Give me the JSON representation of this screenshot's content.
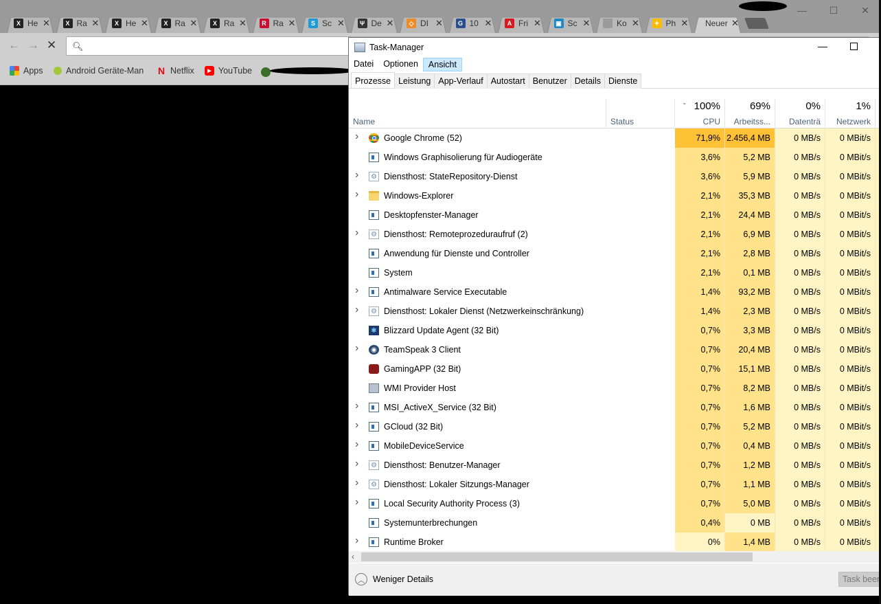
{
  "browser": {
    "tabs": [
      {
        "title": "He",
        "icon": "x-brand-icon",
        "color": "#222222",
        "glyph": "X"
      },
      {
        "title": "Ra",
        "icon": "x-brand-icon",
        "color": "#222222",
        "glyph": "X"
      },
      {
        "title": "He",
        "icon": "x-brand-icon",
        "color": "#222222",
        "glyph": "X"
      },
      {
        "title": "Ra",
        "icon": "x-brand-icon",
        "color": "#222222",
        "glyph": "X"
      },
      {
        "title": "Ra",
        "icon": "x-brand-icon",
        "color": "#222222",
        "glyph": "X"
      },
      {
        "title": "Ra",
        "icon": "red-logo-icon",
        "color": "#c8102e",
        "glyph": "R"
      },
      {
        "title": "Sc",
        "icon": "speech-bubble-icon",
        "color": "#1e9bd7",
        "glyph": "S"
      },
      {
        "title": "De",
        "icon": "trident-icon",
        "color": "#333333",
        "glyph": "Ψ"
      },
      {
        "title": "DI",
        "icon": "diamond-icon",
        "color": "#f08a24",
        "glyph": "◇"
      },
      {
        "title": "10",
        "icon": "cg-icon",
        "color": "#2a4d8f",
        "glyph": "G"
      },
      {
        "title": "Fri",
        "icon": "a1-icon",
        "color": "#d71920",
        "glyph": "A"
      },
      {
        "title": "Sc",
        "icon": "monitor-icon",
        "color": "#1e88c7",
        "glyph": "▣"
      },
      {
        "title": "Ko",
        "icon": "blank-icon",
        "color": "#9b9b9b",
        "glyph": ""
      },
      {
        "title": "Ph",
        "icon": "pinwheel-icon",
        "color": "#fbbc05",
        "glyph": "✦"
      },
      {
        "title": "Neuer",
        "icon": "none",
        "color": "#cfcfcf",
        "glyph": ""
      }
    ],
    "bookmarks": [
      {
        "label": "Apps",
        "icon": "apps-grid-icon"
      },
      {
        "label": "Android Geräte-Man",
        "icon": "android-icon"
      },
      {
        "label": "Netflix",
        "icon": "netflix-icon"
      },
      {
        "label": "YouTube",
        "icon": "youtube-icon"
      }
    ]
  },
  "taskmanager": {
    "title": "Task-Manager",
    "menu": [
      "Datei",
      "Optionen",
      "Ansicht"
    ],
    "tabs": [
      "Prozesse",
      "Leistung",
      "App-Verlauf",
      "Autostart",
      "Benutzer",
      "Details",
      "Dienste"
    ],
    "columns": {
      "name": "Name",
      "status": "Status",
      "cpu": {
        "pct": "100%",
        "label": "CPU"
      },
      "mem": {
        "pct": "69%",
        "label": "Arbeitss..."
      },
      "disk": {
        "pct": "0%",
        "label": "Datenträ"
      },
      "net": {
        "pct": "1%",
        "label": "Netzwerk"
      }
    },
    "rows": [
      {
        "expand": true,
        "icon": "chrome-icon",
        "name": "Google Chrome (52)",
        "cpu": "71,9%",
        "mem": "2.456,4 MB",
        "disk": "0 MB/s",
        "net": "0 MBit/s"
      },
      {
        "expand": false,
        "icon": "window-icon",
        "name": "Windows Graphisolierung für Audiogeräte",
        "cpu": "3,6%",
        "mem": "5,2 MB",
        "disk": "0 MB/s",
        "net": "0 MBit/s"
      },
      {
        "expand": true,
        "icon": "gear-icon",
        "name": "Diensthost: StateRepository-Dienst",
        "cpu": "3,6%",
        "mem": "5,9 MB",
        "disk": "0 MB/s",
        "net": "0 MBit/s"
      },
      {
        "expand": true,
        "icon": "folder-icon",
        "name": "Windows-Explorer",
        "cpu": "2,1%",
        "mem": "35,3 MB",
        "disk": "0 MB/s",
        "net": "0 MBit/s"
      },
      {
        "expand": false,
        "icon": "window-icon",
        "name": "Desktopfenster-Manager",
        "cpu": "2,1%",
        "mem": "24,4 MB",
        "disk": "0 MB/s",
        "net": "0 MBit/s"
      },
      {
        "expand": true,
        "icon": "gear-icon",
        "name": "Diensthost: Remoteprozeduraufruf (2)",
        "cpu": "2,1%",
        "mem": "6,9 MB",
        "disk": "0 MB/s",
        "net": "0 MBit/s"
      },
      {
        "expand": false,
        "icon": "window-icon",
        "name": "Anwendung für Dienste und Controller",
        "cpu": "2,1%",
        "mem": "2,8 MB",
        "disk": "0 MB/s",
        "net": "0 MBit/s"
      },
      {
        "expand": false,
        "icon": "window-icon",
        "name": "System",
        "cpu": "2,1%",
        "mem": "0,1 MB",
        "disk": "0 MB/s",
        "net": "0 MBit/s"
      },
      {
        "expand": true,
        "icon": "window-icon",
        "name": "Antimalware Service Executable",
        "cpu": "1,4%",
        "mem": "93,2 MB",
        "disk": "0 MB/s",
        "net": "0 MBit/s"
      },
      {
        "expand": true,
        "icon": "gear-icon",
        "name": "Diensthost: Lokaler Dienst (Netzwerkeinschränkung)",
        "cpu": "1,4%",
        "mem": "2,3 MB",
        "disk": "0 MB/s",
        "net": "0 MBit/s"
      },
      {
        "expand": false,
        "icon": "blizzard-icon",
        "name": "Blizzard Update Agent (32 Bit)",
        "cpu": "0,7%",
        "mem": "3,3 MB",
        "disk": "0 MB/s",
        "net": "0 MBit/s"
      },
      {
        "expand": true,
        "icon": "teamspeak-icon",
        "name": "TeamSpeak 3 Client",
        "cpu": "0,7%",
        "mem": "20,4 MB",
        "disk": "0 MB/s",
        "net": "0 MBit/s"
      },
      {
        "expand": false,
        "icon": "gaming-app-icon",
        "name": "GamingAPP (32 Bit)",
        "cpu": "0,7%",
        "mem": "15,1 MB",
        "disk": "0 MB/s",
        "net": "0 MBit/s"
      },
      {
        "expand": false,
        "icon": "wmi-icon",
        "name": "WMI Provider Host",
        "cpu": "0,7%",
        "mem": "8,2 MB",
        "disk": "0 MB/s",
        "net": "0 MBit/s"
      },
      {
        "expand": true,
        "icon": "window-icon",
        "name": "MSI_ActiveX_Service (32 Bit)",
        "cpu": "0,7%",
        "mem": "1,6 MB",
        "disk": "0 MB/s",
        "net": "0 MBit/s"
      },
      {
        "expand": true,
        "icon": "window-icon",
        "name": "GCloud (32 Bit)",
        "cpu": "0,7%",
        "mem": "5,2 MB",
        "disk": "0 MB/s",
        "net": "0 MBit/s"
      },
      {
        "expand": true,
        "icon": "window-icon",
        "name": "MobileDeviceService",
        "cpu": "0,7%",
        "mem": "0,4 MB",
        "disk": "0 MB/s",
        "net": "0 MBit/s"
      },
      {
        "expand": true,
        "icon": "gear-icon",
        "name": "Diensthost: Benutzer-Manager",
        "cpu": "0,7%",
        "mem": "1,2 MB",
        "disk": "0 MB/s",
        "net": "0 MBit/s"
      },
      {
        "expand": true,
        "icon": "gear-icon",
        "name": "Diensthost: Lokaler Sitzungs-Manager",
        "cpu": "0,7%",
        "mem": "1,1 MB",
        "disk": "0 MB/s",
        "net": "0 MBit/s"
      },
      {
        "expand": true,
        "icon": "window-icon",
        "name": "Local Security Authority Process (3)",
        "cpu": "0,7%",
        "mem": "5,0 MB",
        "disk": "0 MB/s",
        "net": "0 MBit/s"
      },
      {
        "expand": false,
        "icon": "window-icon",
        "name": "Systemunterbrechungen",
        "cpu": "0,4%",
        "mem": "0 MB",
        "disk": "0 MB/s",
        "net": "0 MBit/s"
      },
      {
        "expand": true,
        "icon": "window-icon",
        "name": "Runtime Broker",
        "cpu": "0%",
        "mem": "1,4 MB",
        "disk": "0 MB/s",
        "net": "0 MBit/s"
      }
    ],
    "footer": {
      "fewer_details": "Weniger Details",
      "end_task": "Task beenden"
    },
    "colors": {
      "heat_high": "#ffc135",
      "heat_mid": "#ffe28a",
      "heat_low": "#fff4c4",
      "accent": "#cce8ff"
    }
  }
}
